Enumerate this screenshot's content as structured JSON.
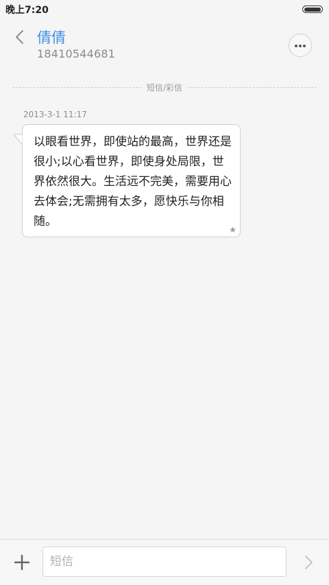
{
  "status_bar": {
    "time": "晚上7:20",
    "icons": [
      "battery-icon"
    ]
  },
  "header": {
    "back_icon": "chevron-left-icon",
    "contact_name": "倩倩",
    "contact_number": "18410544681",
    "more_icon": "more-horizontal-icon"
  },
  "conversation": {
    "divider_label": "短信/彩信",
    "messages": [
      {
        "timestamp": "2013-3-1 11:17",
        "text": "以眼看世界，即使站的最高，世界还是很小;以心看世界，即使身处局限，世界依然很大。生活远不完美，需要用心去体会;无需拥有太多，愿快乐与你相随。",
        "starred": true,
        "star_icon": "star-icon"
      }
    ]
  },
  "composer": {
    "add_icon": "plus-icon",
    "placeholder": "短信",
    "value": "",
    "send_icon": "chevron-right-icon"
  },
  "colors": {
    "accent": "#3f8ee8",
    "background": "#f5f5f5",
    "bubble": "#ffffff",
    "secondary_text": "#8a8a8a"
  }
}
